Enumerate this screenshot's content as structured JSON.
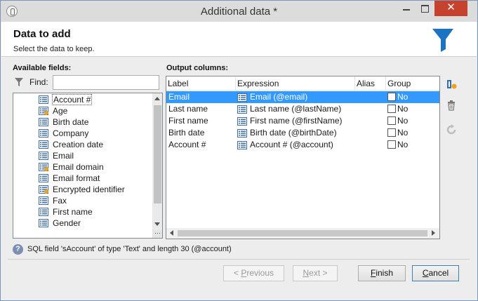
{
  "window": {
    "title": "Additional data *",
    "close_label": "✕"
  },
  "header": {
    "title": "Data to add",
    "subtitle": "Select the data to keep."
  },
  "available": {
    "label": "Available fields:",
    "find_label": "Find:",
    "find_value": "",
    "fields": [
      {
        "label": "Account #",
        "icon": "field-list-icon",
        "selected": true
      },
      {
        "label": "Age",
        "icon": "calculated-field-icon"
      },
      {
        "label": "Birth date",
        "icon": "field-list-icon"
      },
      {
        "label": "Company",
        "icon": "field-list-icon"
      },
      {
        "label": "Creation date",
        "icon": "field-list-icon"
      },
      {
        "label": "Email",
        "icon": "field-list-icon"
      },
      {
        "label": "Email domain",
        "icon": "calculated-field-icon"
      },
      {
        "label": "Email format",
        "icon": "field-list-icon"
      },
      {
        "label": "Encrypted identifier",
        "icon": "calculated-field-icon"
      },
      {
        "label": "Fax",
        "icon": "field-list-icon"
      },
      {
        "label": "First name",
        "icon": "field-list-icon"
      },
      {
        "label": "Gender",
        "icon": "field-list-icon"
      }
    ]
  },
  "output": {
    "label": "Output columns:",
    "columns": [
      "Label",
      "Expression",
      "Alias",
      "Group"
    ],
    "rows": [
      {
        "label": "Email",
        "expression": "Email (@email)",
        "alias": "",
        "group": "No",
        "selected": true
      },
      {
        "label": "Last name",
        "expression": "Last name (@lastName)",
        "alias": "",
        "group": "No"
      },
      {
        "label": "First name",
        "expression": "First name (@firstName)",
        "alias": "",
        "group": "No"
      },
      {
        "label": "Birth date",
        "expression": "Birth date (@birthDate)",
        "alias": "",
        "group": "No"
      },
      {
        "label": "Account #",
        "expression": "Account # (@account)",
        "alias": "",
        "group": "No"
      }
    ]
  },
  "side_icons": [
    "add-column-icon",
    "trash-icon",
    "refresh-icon"
  ],
  "info": {
    "text": "SQL field 'sAccount' of type 'Text' and length 30 (@account)"
  },
  "buttons": {
    "previous": {
      "u": "P",
      "rest": "revious",
      "pre": "< "
    },
    "next": {
      "u": "N",
      "rest": "ext >",
      "pre": ""
    },
    "finish": {
      "u": "F",
      "rest": "inish",
      "pre": ""
    },
    "cancel": {
      "u": "C",
      "rest": "ancel",
      "pre": ""
    }
  },
  "colors": {
    "selection": "#3399ff",
    "accent": "#1b73c4",
    "close": "#c7412f"
  }
}
